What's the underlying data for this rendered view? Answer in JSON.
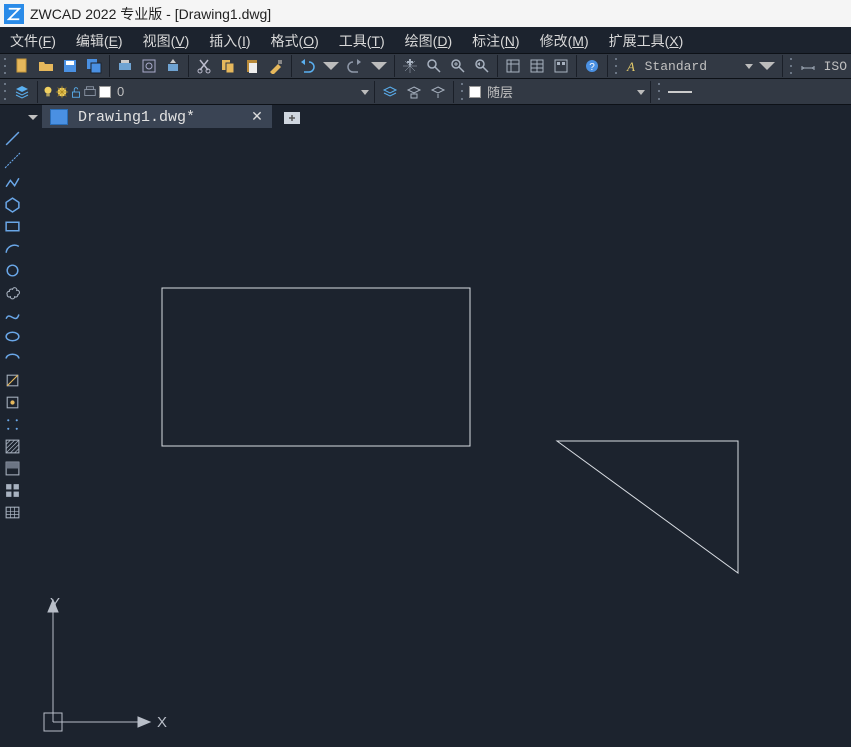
{
  "title": "ZWCAD 2022 专业版 - [Drawing1.dwg]",
  "menu": {
    "file": {
      "label": "文件",
      "key": "F"
    },
    "edit": {
      "label": "编辑",
      "key": "E"
    },
    "view": {
      "label": "视图",
      "key": "V"
    },
    "insert": {
      "label": "插入",
      "key": "I"
    },
    "format": {
      "label": "格式",
      "key": "O"
    },
    "tools": {
      "label": "工具",
      "key": "T"
    },
    "draw": {
      "label": "绘图",
      "key": "D"
    },
    "annotate": {
      "label": "标注",
      "key": "N"
    },
    "modify": {
      "label": "修改",
      "key": "M"
    },
    "extensions": {
      "label": "扩展工具",
      "key": "X"
    }
  },
  "textstyle": {
    "value": "Standard"
  },
  "iso_label": "ISO",
  "layer": {
    "current": "0"
  },
  "bylayer": {
    "value": "随层"
  },
  "tab": {
    "name": "Drawing1.dwg*"
  },
  "ucs": {
    "x": "X",
    "y": "Y"
  }
}
